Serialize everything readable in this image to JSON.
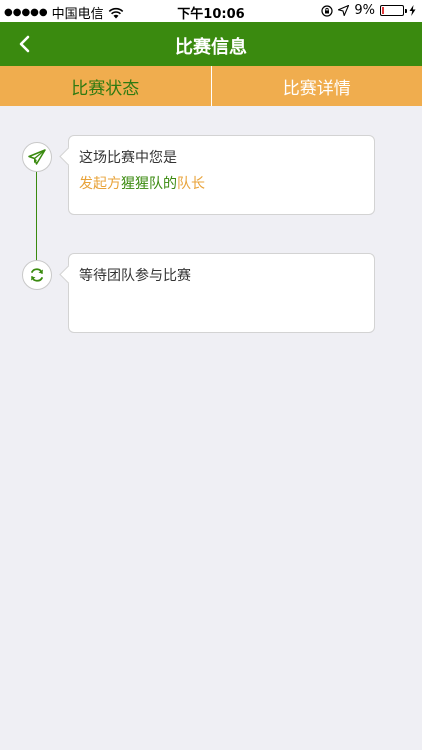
{
  "status_bar": {
    "signal_dots": "●●●●●",
    "carrier": "中国电信",
    "time": "下午10:06",
    "battery_percent": "9%",
    "battery_level": 0.09
  },
  "nav": {
    "title": "比赛信息"
  },
  "tabs": [
    {
      "label": "比赛状态",
      "active": true
    },
    {
      "label": "比赛详情",
      "active": false
    }
  ],
  "timeline": [
    {
      "icon": "paper-plane-icon",
      "line1": "这场比赛中您是",
      "line2_parts": [
        {
          "text": "发起方",
          "color": "orange"
        },
        {
          "text": "猩猩队",
          "color": "green"
        },
        {
          "text": "的",
          "color": "green"
        },
        {
          "text": "队长",
          "color": "orange"
        }
      ]
    },
    {
      "icon": "refresh-icon",
      "line1": "等待团队参与比赛"
    }
  ],
  "colors": {
    "nav_green": "#3a8a0f",
    "tab_orange": "#f0ad4e",
    "text_orange": "#e8a33a",
    "background": "#efeff4"
  }
}
